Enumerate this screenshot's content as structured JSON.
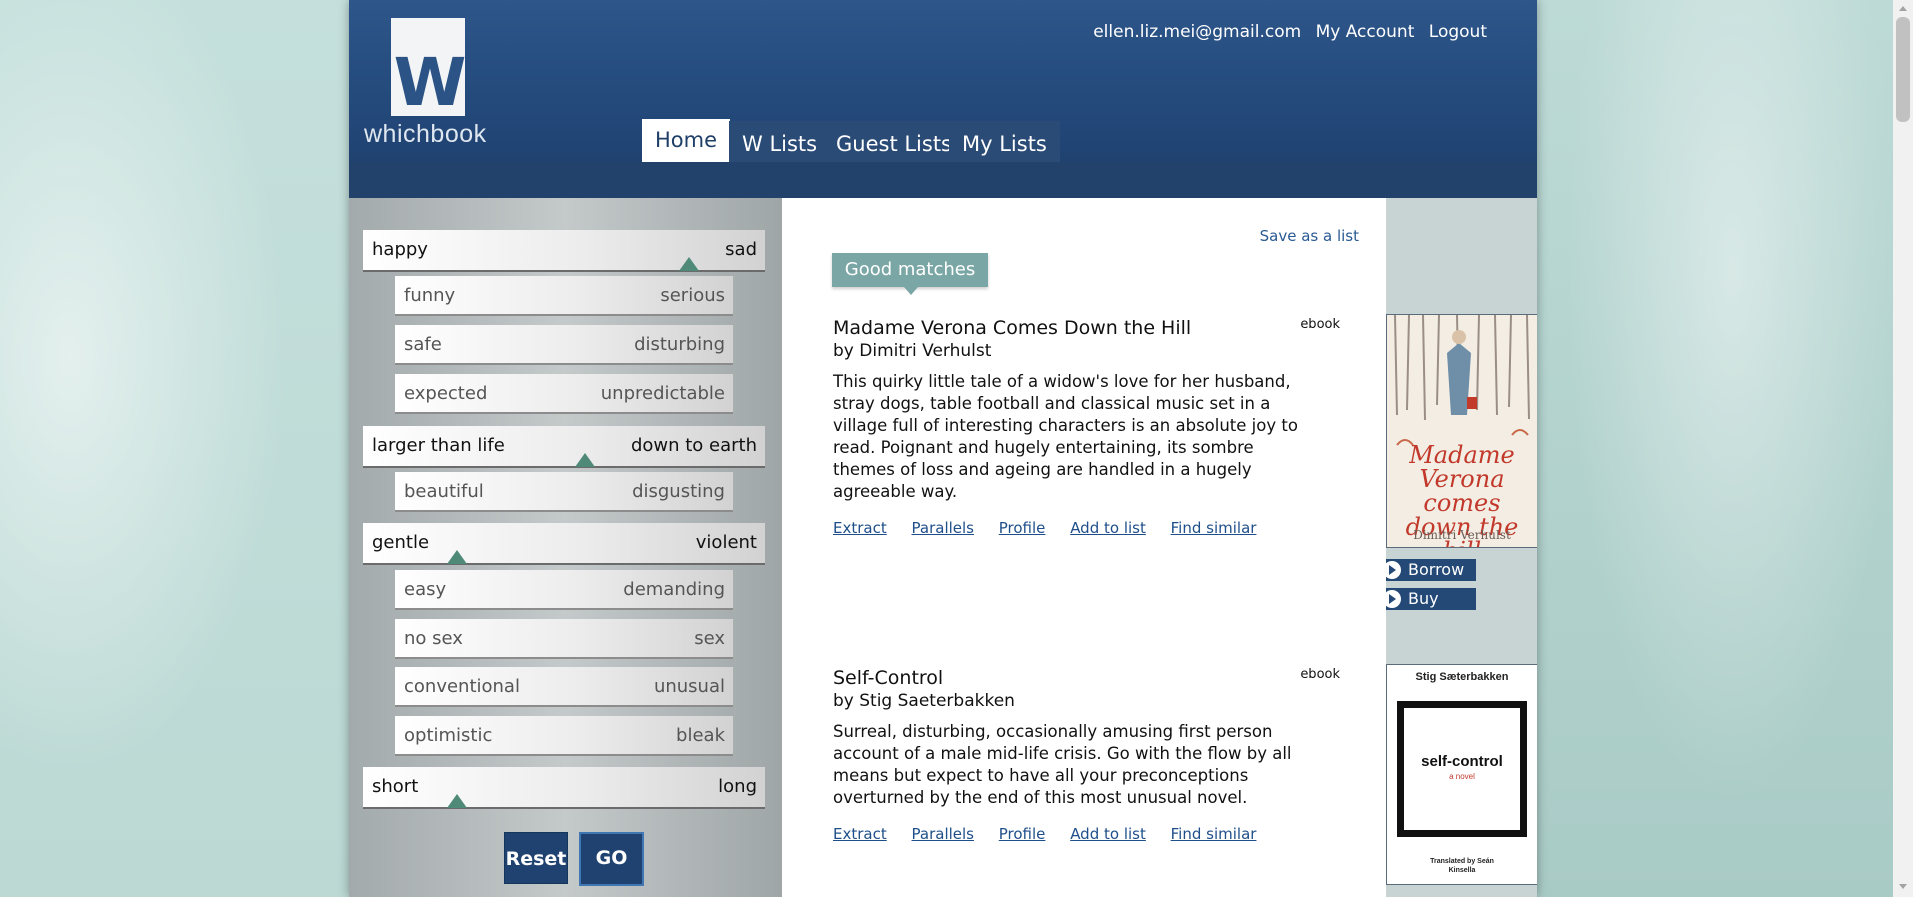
{
  "header": {
    "logo_text": "whichbook",
    "logo_letter": "W",
    "user_email": "ellen.liz.mei@gmail.com",
    "my_account": "My Account",
    "logout": "Logout"
  },
  "nav": {
    "tabs": [
      {
        "label": "Home",
        "active": true
      },
      {
        "label": "W Lists",
        "active": false
      },
      {
        "label": "Guest Lists",
        "active": false
      },
      {
        "label": "My Lists",
        "active": false
      }
    ]
  },
  "sliders": {
    "happy_sad": {
      "left": "happy",
      "right": "sad",
      "value": 0.82
    },
    "funny_serious": {
      "left": "funny",
      "right": "serious"
    },
    "safe_disturbing": {
      "left": "safe",
      "right": "disturbing"
    },
    "expected_unpredictable": {
      "left": "expected",
      "right": "unpredictable"
    },
    "larger_down": {
      "left": "larger than life",
      "right": "down to earth",
      "value": 0.55
    },
    "beautiful_disgusting": {
      "left": "beautiful",
      "right": "disgusting"
    },
    "gentle_violent": {
      "left": "gentle",
      "right": "violent",
      "value": 0.23
    },
    "easy_demanding": {
      "left": "easy",
      "right": "demanding"
    },
    "nosex_sex": {
      "left": "no sex",
      "right": "sex"
    },
    "conventional_unusual": {
      "left": "conventional",
      "right": "unusual"
    },
    "optimistic_bleak": {
      "left": "optimistic",
      "right": "bleak"
    },
    "short_long": {
      "left": "short",
      "right": "long",
      "value": 0.23
    }
  },
  "buttons": {
    "reset": "Reset",
    "go": "GO"
  },
  "results": {
    "save_as_list": "Save as a list",
    "section_label": "Good matches",
    "books": [
      {
        "title": "Madame Verona Comes Down the Hill",
        "author": "by Dimitri Verhulst",
        "format": "ebook",
        "description": "This quirky little tale of a widow's love for her husband, stray dogs, table football and classical music set in a village full of interesting characters is an absolute joy to read. Poignant and hugely entertaining, its sombre themes of loss and ageing are handled in a hugely agreeable way.",
        "links": [
          "Extract",
          "Parallels",
          "Profile",
          "Add to list",
          "Find similar"
        ],
        "cover_title": "Madame Verona comes down the hill",
        "cover_author": "Dimitri Verhulst"
      },
      {
        "title": "Self-Control",
        "author": "by Stig Saeterbakken",
        "format": "ebook",
        "description": "Surreal, disturbing, occasionally amusing first person account of a male mid-life crisis. Go with the flow by all means but expect to have all your preconceptions overturned by the end of this most unusual novel.",
        "links": [
          "Extract",
          "Parallels",
          "Profile",
          "Add to list",
          "Find similar"
        ],
        "cover_title": "self-control",
        "cover_subtitle": "a novel",
        "cover_author": "Stig Sæterbakken",
        "cover_translator": "Translated by Seán Kinsella"
      }
    ],
    "borrow": "Borrow",
    "buy": "Buy"
  },
  "colors": {
    "header_blue": "#2e568a",
    "tab_blue": "#2a4b76",
    "slider_knob": "#4f8a79",
    "good_matches": "#7aa7a5",
    "link_blue": "#1f4f8a"
  }
}
